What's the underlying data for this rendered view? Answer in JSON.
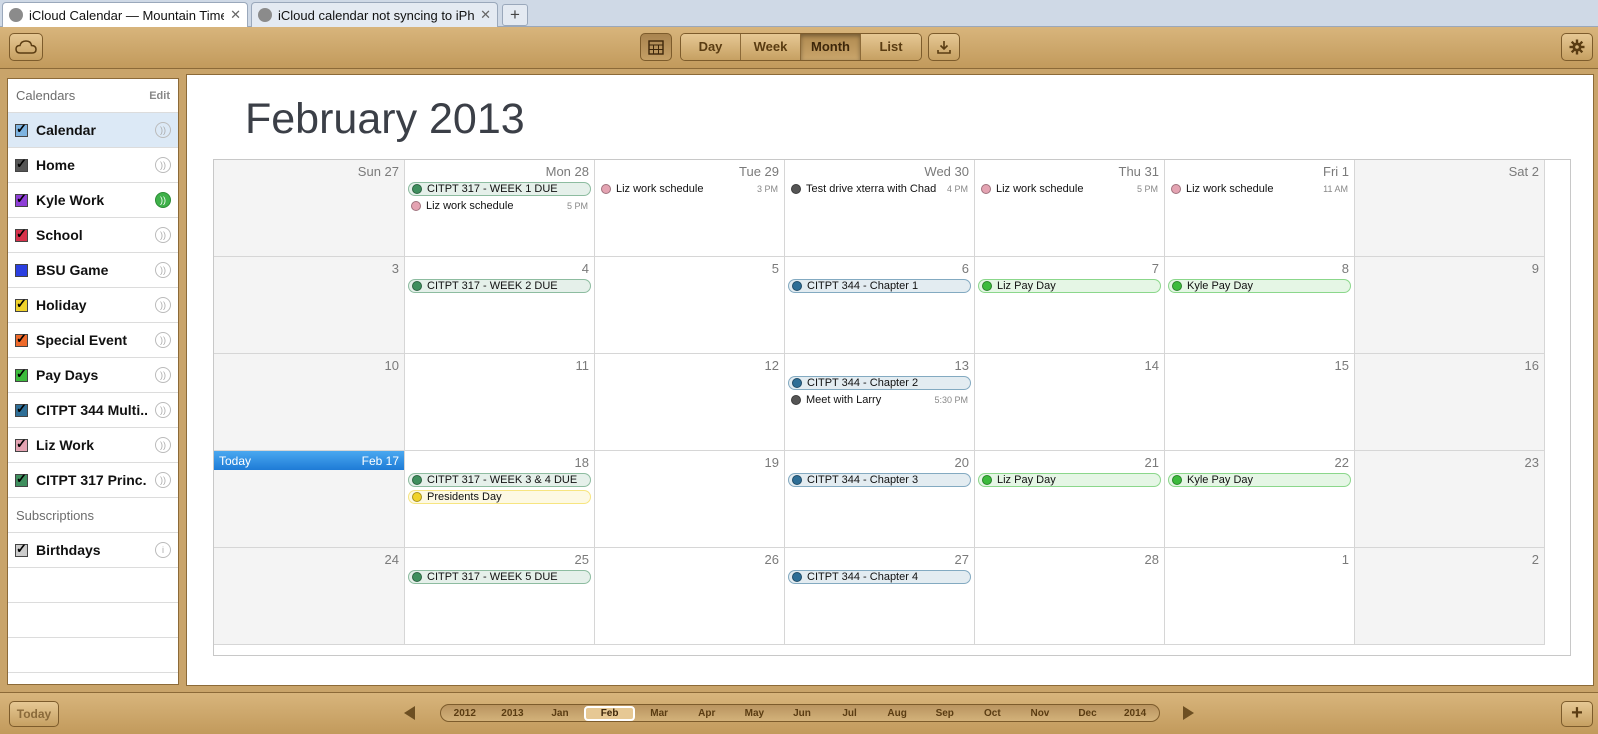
{
  "browser": {
    "tabs": [
      {
        "title": "iCloud Calendar — Mountain Time",
        "active": true
      },
      {
        "title": "iCloud calendar not syncing to iPhon...",
        "active": false
      }
    ],
    "new_tab": "+"
  },
  "toolbar": {
    "views": [
      "Day",
      "Week",
      "Month",
      "List"
    ],
    "selected_view": "Month"
  },
  "sidebar": {
    "header": "Calendars",
    "edit": "Edit",
    "calendars": [
      {
        "name": "Calendar",
        "color": "#7db3e0",
        "shared": false,
        "selected": true
      },
      {
        "name": "Home",
        "color": "#555555",
        "shared": false
      },
      {
        "name": "Kyle Work",
        "color": "#8e3fd6",
        "shared": true
      },
      {
        "name": "School",
        "color": "#d6304a",
        "shared": false
      },
      {
        "name": "BSU Game",
        "color": "#2b3fe0",
        "shared": false,
        "unchecked": true
      },
      {
        "name": "Holiday",
        "color": "#f0d22a",
        "shared": false
      },
      {
        "name": "Special Event",
        "color": "#ee6a2b",
        "shared": false
      },
      {
        "name": "Pay Days",
        "color": "#3cbb3c",
        "shared": false
      },
      {
        "name": "CITPT 344 Multi...",
        "color": "#2e6e96",
        "shared": false
      },
      {
        "name": "Liz Work",
        "color": "#e4a3b2",
        "shared": false
      },
      {
        "name": "CITPT 317 Princ...",
        "color": "#3f8f5e",
        "shared": false
      }
    ],
    "subscriptions_header": "Subscriptions",
    "subscriptions": [
      {
        "name": "Birthdays",
        "color": "#cccccc"
      }
    ]
  },
  "main": {
    "title": "February 2013",
    "weeks": [
      [
        {
          "label": "Sun 27",
          "weekend": true,
          "events": []
        },
        {
          "label": "Mon 28",
          "events": [
            {
              "title": "CITPT 317 - WEEK 1 DUE",
              "color": "#3f8f5e",
              "allday": true
            },
            {
              "title": "Liz work schedule",
              "color": "#e4a3b2",
              "time": "5 PM"
            }
          ]
        },
        {
          "label": "Tue 29",
          "events": [
            {
              "title": "Liz work schedule",
              "color": "#e4a3b2",
              "time": "3 PM"
            }
          ]
        },
        {
          "label": "Wed 30",
          "events": [
            {
              "title": "Test drive xterra with Chad",
              "color": "#555555",
              "time": "4 PM"
            }
          ]
        },
        {
          "label": "Thu 31",
          "events": [
            {
              "title": "Liz work schedule",
              "color": "#e4a3b2",
              "time": "5 PM"
            }
          ]
        },
        {
          "label": "Fri 1",
          "events": [
            {
              "title": "Liz work schedule",
              "color": "#e4a3b2",
              "time": "11 AM"
            }
          ]
        },
        {
          "label": "Sat 2",
          "weekend": true,
          "events": []
        }
      ],
      [
        {
          "label": "3",
          "weekend": true,
          "events": []
        },
        {
          "label": "4",
          "events": [
            {
              "title": "CITPT 317 - WEEK 2 DUE",
              "color": "#3f8f5e",
              "allday": true
            }
          ]
        },
        {
          "label": "5",
          "events": []
        },
        {
          "label": "6",
          "events": [
            {
              "title": "CITPT 344 - Chapter 1",
              "color": "#2e6e96",
              "allday": true
            }
          ]
        },
        {
          "label": "7",
          "events": [
            {
              "title": "Liz Pay Day",
              "color": "#3cbb3c",
              "allday": true
            }
          ]
        },
        {
          "label": "8",
          "events": [
            {
              "title": "Kyle Pay Day",
              "color": "#3cbb3c",
              "allday": true
            }
          ]
        },
        {
          "label": "9",
          "weekend": true,
          "events": []
        }
      ],
      [
        {
          "label": "10",
          "weekend": true,
          "events": []
        },
        {
          "label": "11",
          "events": []
        },
        {
          "label": "12",
          "events": []
        },
        {
          "label": "13",
          "events": [
            {
              "title": "CITPT 344 - Chapter 2",
              "color": "#2e6e96",
              "allday": true
            },
            {
              "title": "Meet with Larry",
              "color": "#555555",
              "time": "5:30 PM"
            }
          ]
        },
        {
          "label": "14",
          "events": []
        },
        {
          "label": "15",
          "events": []
        },
        {
          "label": "16",
          "weekend": true,
          "events": []
        }
      ],
      [
        {
          "label": "",
          "weekend": true,
          "today": true,
          "today_label": "Today",
          "today_date": "Feb 17",
          "events": []
        },
        {
          "label": "18",
          "events": [
            {
              "title": "CITPT 317 - WEEK 3 & 4 DUE",
              "color": "#3f8f5e",
              "allday": true
            },
            {
              "title": "Presidents Day",
              "color": "#f0d22a",
              "allday": true
            }
          ]
        },
        {
          "label": "19",
          "events": []
        },
        {
          "label": "20",
          "events": [
            {
              "title": "CITPT 344 - Chapter 3",
              "color": "#2e6e96",
              "allday": true
            }
          ]
        },
        {
          "label": "21",
          "events": [
            {
              "title": "Liz Pay Day",
              "color": "#3cbb3c",
              "allday": true
            }
          ]
        },
        {
          "label": "22",
          "events": [
            {
              "title": "Kyle Pay Day",
              "color": "#3cbb3c",
              "allday": true
            }
          ]
        },
        {
          "label": "23",
          "weekend": true,
          "events": []
        }
      ],
      [
        {
          "label": "24",
          "weekend": true,
          "events": []
        },
        {
          "label": "25",
          "events": [
            {
              "title": "CITPT 317 - WEEK 5 DUE",
              "color": "#3f8f5e",
              "allday": true
            }
          ]
        },
        {
          "label": "26",
          "events": []
        },
        {
          "label": "27",
          "events": [
            {
              "title": "CITPT 344 - Chapter 4",
              "color": "#2e6e96",
              "allday": true
            }
          ]
        },
        {
          "label": "28",
          "events": []
        },
        {
          "label": "1",
          "events": []
        },
        {
          "label": "2",
          "weekend": true,
          "events": []
        }
      ]
    ]
  },
  "bottom": {
    "today_button": "Today",
    "timeline": [
      "2012",
      "2013",
      "Jan",
      "Feb",
      "Mar",
      "Apr",
      "May",
      "Jun",
      "Jul",
      "Aug",
      "Sep",
      "Oct",
      "Nov",
      "Dec",
      "2014"
    ],
    "timeline_selected": "Feb",
    "add_button": "+"
  }
}
